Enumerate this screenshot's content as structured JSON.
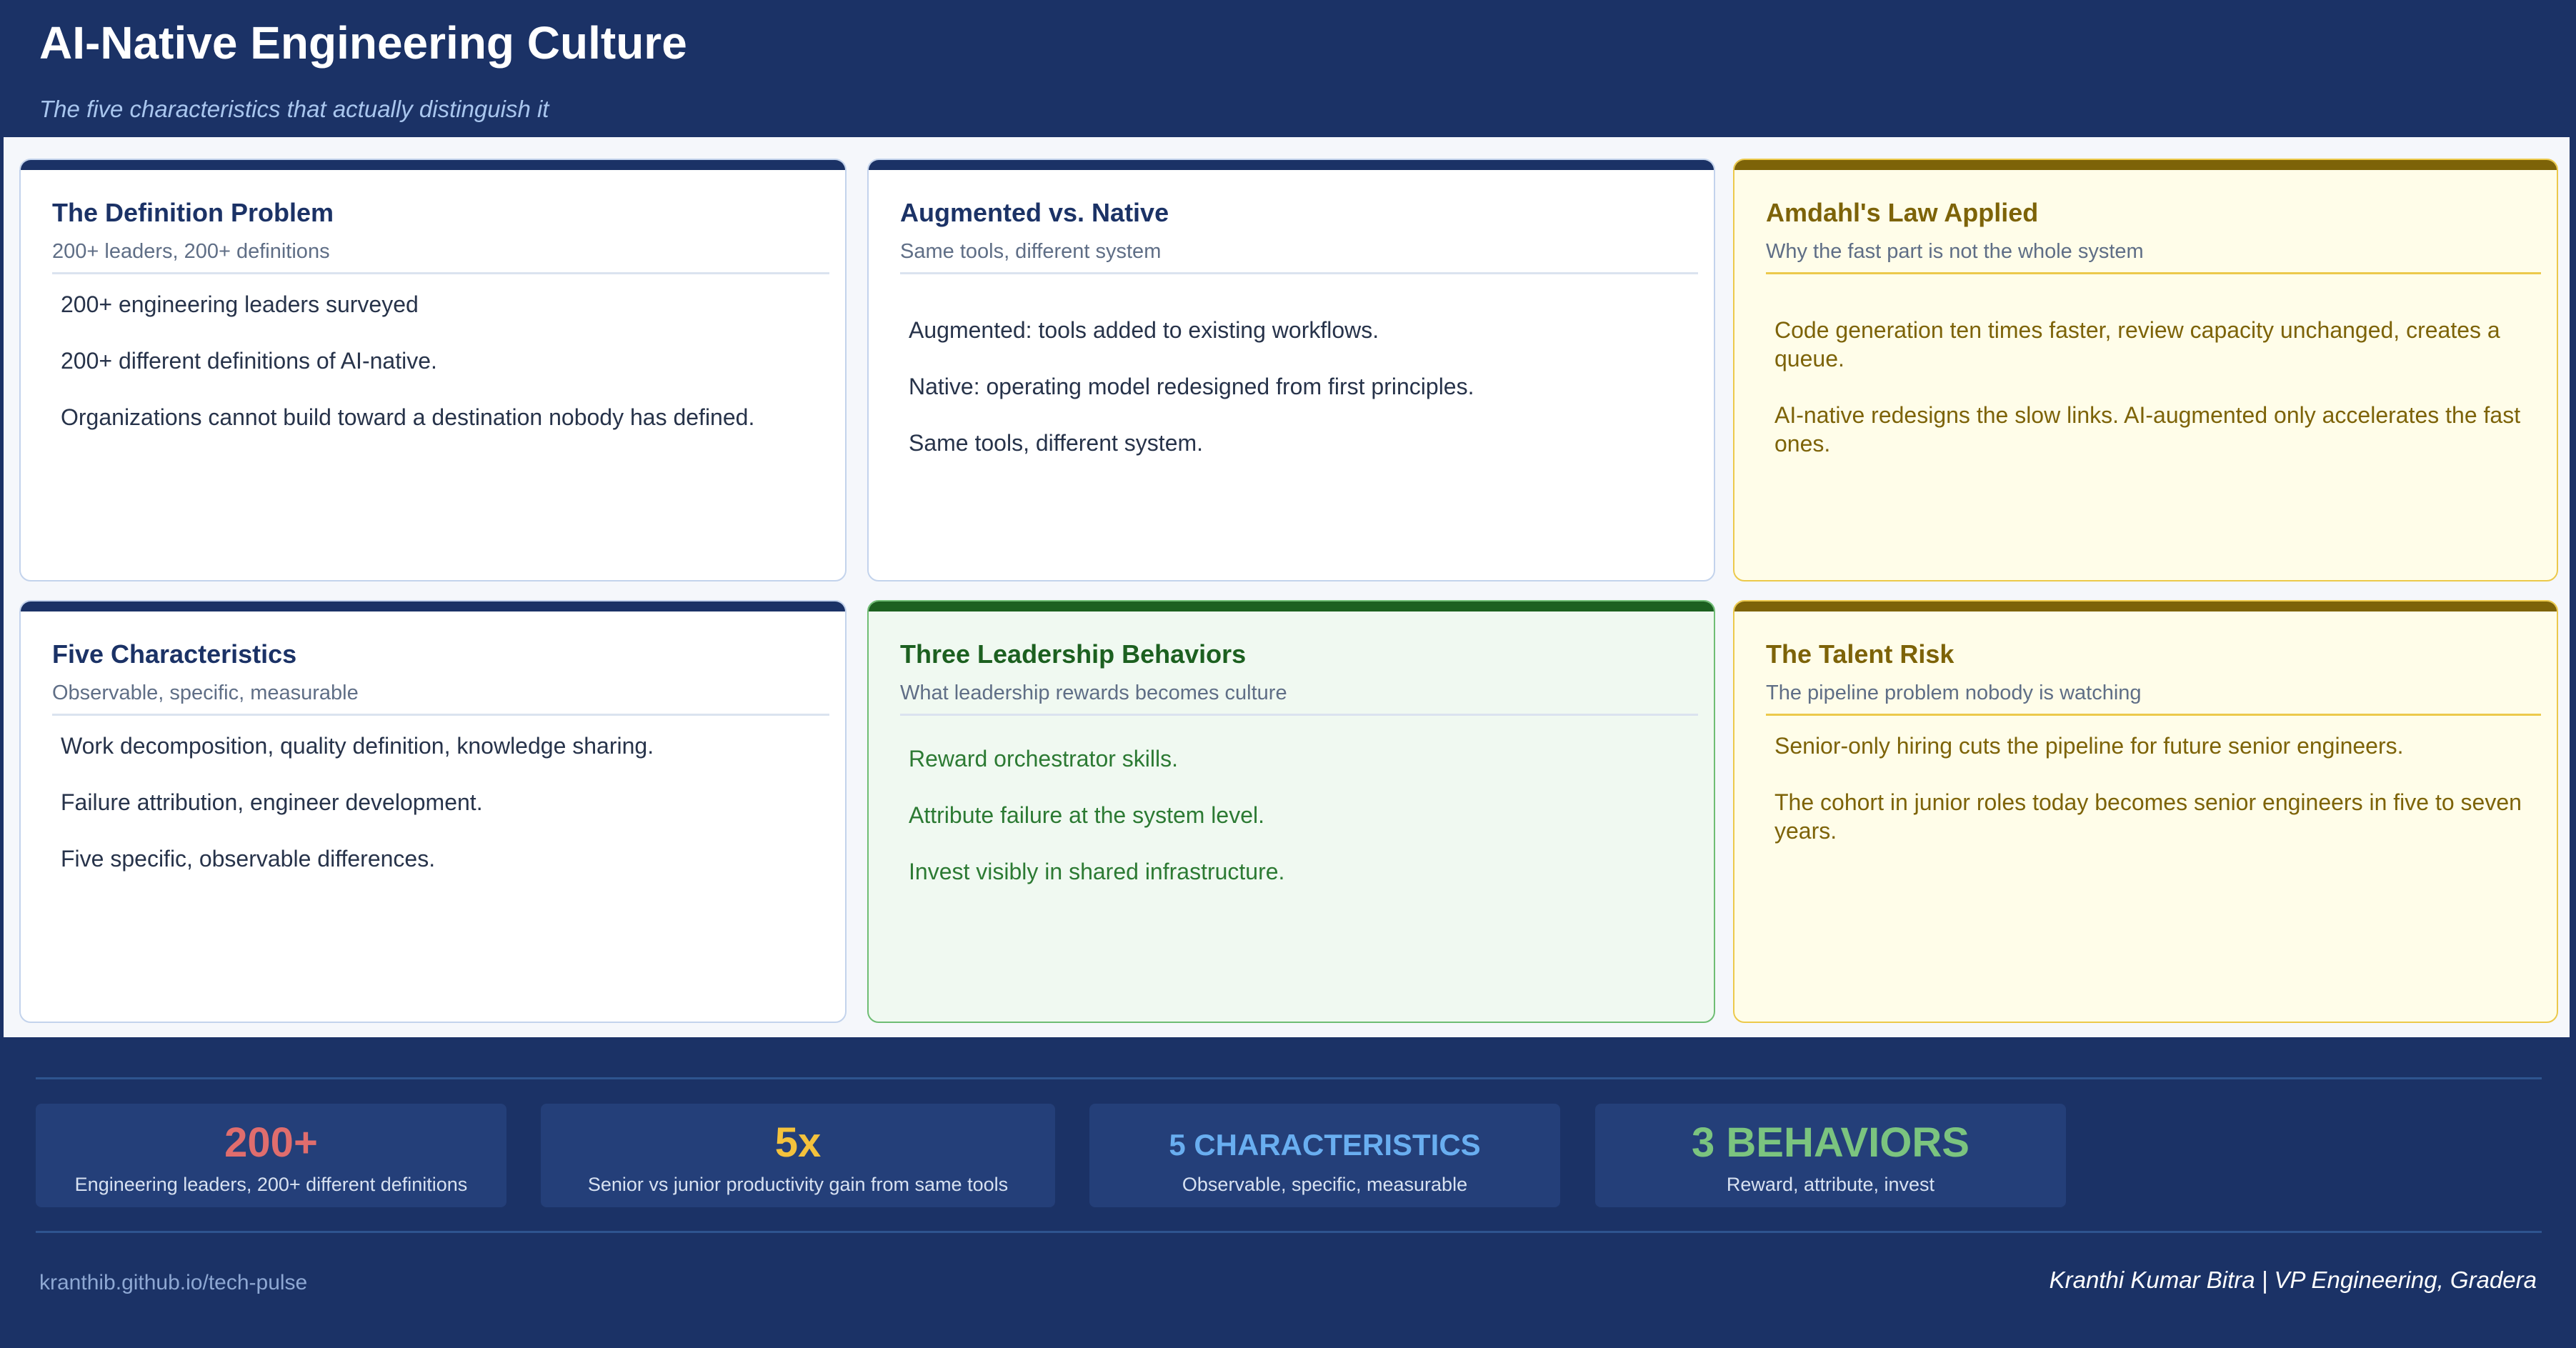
{
  "header": {
    "title": "AI-Native Engineering Culture",
    "subtitle": "The five characteristics that actually distinguish it"
  },
  "cards": [
    {
      "title": "The Definition Problem",
      "subtitle": "200+ leaders, 200+ definitions",
      "points": [
        "200+ engineering leaders surveyed",
        "200+ different definitions of AI-native.",
        "Organizations cannot build toward a destination nobody has defined."
      ]
    },
    {
      "title": "Augmented vs. Native",
      "subtitle": "Same tools, different system",
      "points": [
        "Augmented: tools added to existing workflows.",
        "Native: operating model redesigned from first principles.",
        "Same tools, different system."
      ]
    },
    {
      "title": "Amdahl's Law Applied",
      "subtitle": "Why the fast part is not the whole system",
      "points": [
        "Code generation ten times faster, review capacity unchanged, creates a queue.",
        "AI-native redesigns the slow links. AI-augmented only accelerates the fast ones."
      ]
    },
    {
      "title": "Five Characteristics",
      "subtitle": "Observable, specific, measurable",
      "points": [
        "Work decomposition, quality definition, knowledge sharing.",
        "Failure attribution, engineer development.",
        "Five specific, observable differences."
      ]
    },
    {
      "title": "Three Leadership Behaviors",
      "subtitle": "What leadership rewards becomes culture",
      "points": [
        "Reward orchestrator skills.",
        "Attribute failure at the system level.",
        "Invest visibly in shared infrastructure."
      ]
    },
    {
      "title": "The Talent Risk",
      "subtitle": "The pipeline problem nobody is watching",
      "points": [
        "Senior-only hiring cuts the pipeline for future senior engineers.",
        "The cohort in junior roles today becomes senior engineers in five to seven years."
      ]
    }
  ],
  "stats": [
    {
      "value": "200+",
      "label": "Engineering leaders, 200+ different definitions",
      "color": "#e06d6d"
    },
    {
      "value": "5x",
      "label": "Senior vs junior productivity gain from same tools",
      "color": "#f4c23c"
    },
    {
      "value": "5 CHARACTERISTICS",
      "label": "Observable, specific, measurable",
      "color": "#69aef0"
    },
    {
      "value": "3 BEHAVIORS",
      "label": "Reward, attribute, invest",
      "color": "#7bc47f"
    }
  ],
  "footer": {
    "url": "kranthib.github.io/tech-pulse",
    "author": "Kranthi Kumar Bitra | VP Engineering, Gradera"
  },
  "theme": {
    "navy": "#1b3266",
    "gold": "#7d6308",
    "green": "#1c6020"
  }
}
